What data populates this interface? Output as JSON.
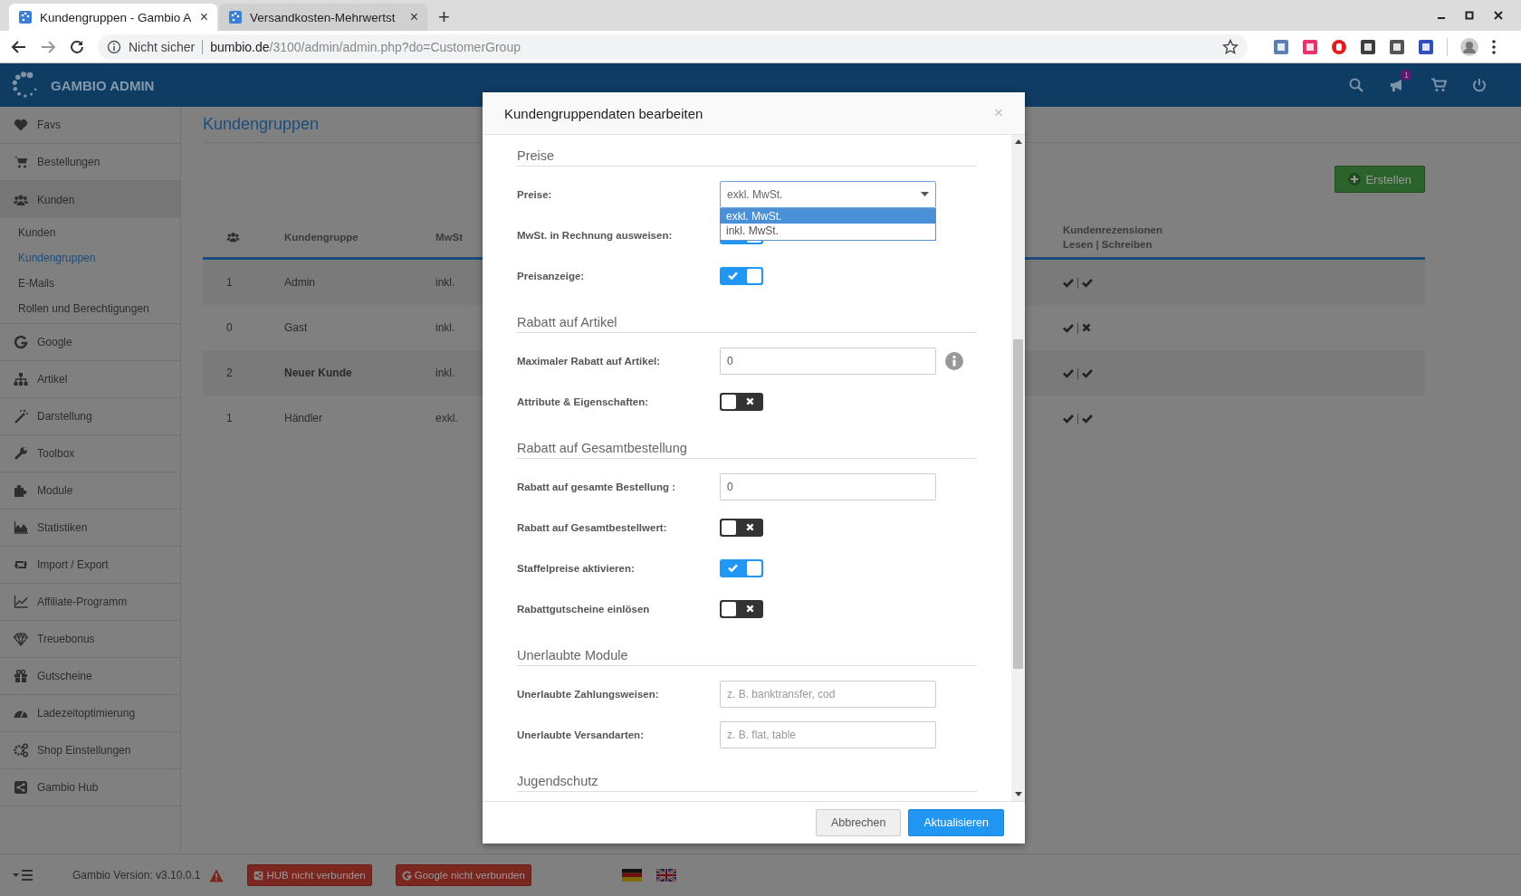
{
  "browser": {
    "tabs": [
      {
        "title": "Kundengruppen - Gambio A",
        "close": "×",
        "selected": true
      },
      {
        "title": "Versandkosten-Mehrwertst",
        "close": "×",
        "selected": false
      }
    ],
    "new_tab": "+",
    "security_label": "Nicht sicher",
    "url_host": "bumbio.de",
    "url_path": "/3100/admin/admin.php?do=CustomerGroup"
  },
  "header": {
    "brand": "GAMBIO ADMIN",
    "notification_count": "1"
  },
  "sidebar": {
    "items": [
      {
        "label": "Favs",
        "expanded": false
      },
      {
        "label": "Bestellungen",
        "expanded": false
      },
      {
        "label": "Kunden",
        "expanded": true,
        "children": [
          {
            "label": "Kunden",
            "selected": false
          },
          {
            "label": "Kundengruppen",
            "selected": true
          },
          {
            "label": "E-Mails",
            "selected": false
          },
          {
            "label": "Rollen und Berechtigungen",
            "selected": false
          }
        ]
      },
      {
        "label": "Google",
        "expanded": false
      },
      {
        "label": "Artikel",
        "expanded": false
      },
      {
        "label": "Darstellung",
        "expanded": false
      },
      {
        "label": "Toolbox",
        "expanded": false
      },
      {
        "label": "Module",
        "expanded": false
      },
      {
        "label": "Statistiken",
        "expanded": false
      },
      {
        "label": "Import / Export",
        "expanded": false
      },
      {
        "label": "Affiliate-Programm",
        "expanded": false
      },
      {
        "label": "Treuebonus",
        "expanded": false
      },
      {
        "label": "Gutscheine",
        "expanded": false
      },
      {
        "label": "Ladezeitoptimierung",
        "expanded": false
      },
      {
        "label": "Shop Einstellungen",
        "expanded": false
      },
      {
        "label": "Gambio Hub",
        "expanded": false
      }
    ]
  },
  "page": {
    "title": "Kundengruppen",
    "create_button": "Erstellen",
    "table": {
      "columns": [
        "Kundengruppe",
        "MwSt"
      ],
      "reviews_column": [
        "Kundenrezensionen",
        "Lesen | Schreiben"
      ],
      "rows": [
        {
          "members": "1",
          "name": "Admin",
          "vat": "inkl.",
          "is_default": false,
          "review_read": true,
          "review_separator": "|",
          "review_write": true
        },
        {
          "members": "0",
          "name": "Gast",
          "vat": "inkl.",
          "is_default": false,
          "review_read": true,
          "review_separator": "|",
          "review_write": false
        },
        {
          "members": "2",
          "name": "Neuer Kunde",
          "vat": "inkl.",
          "is_default": true,
          "review_read": true,
          "review_separator": "|",
          "review_write": true
        },
        {
          "members": "1",
          "name": "Händler",
          "vat": "exkl.",
          "is_default": false,
          "review_read": true,
          "review_separator": "|",
          "review_write": true
        }
      ]
    }
  },
  "modal": {
    "title": "Kundengruppendaten bearbeiten",
    "close": "×",
    "sections": [
      {
        "heading": "Preise",
        "rows": [
          {
            "kind": "select",
            "label": "Preise:",
            "value": "exkl. MwSt.",
            "options": [
              {
                "label": "exkl. MwSt.",
                "selected": true
              },
              {
                "label": "inkl. MwSt.",
                "selected": false
              }
            ]
          },
          {
            "kind": "toggle",
            "label": "MwSt. in Rechnung ausweisen:",
            "on": true
          },
          {
            "kind": "toggle",
            "label": "Preisanzeige:",
            "on": true
          }
        ]
      },
      {
        "heading": "Rabatt auf Artikel",
        "rows": [
          {
            "kind": "input",
            "label": "Maximaler Rabatt auf Artikel:",
            "value": "0",
            "info": true
          },
          {
            "kind": "toggle",
            "label": "Attribute & Eigenschaften:",
            "on": false
          }
        ]
      },
      {
        "heading": "Rabatt auf Gesamtbestellung",
        "rows": [
          {
            "kind": "input",
            "label": "Rabatt auf gesamte Bestellung :",
            "value": "0"
          },
          {
            "kind": "toggle",
            "label": "Rabatt auf Gesamtbestellwert:",
            "on": false
          },
          {
            "kind": "toggle",
            "label": "Staffelpreise aktivieren:",
            "on": true
          },
          {
            "kind": "toggle",
            "label": "Rabattgutscheine einlösen",
            "on": false
          }
        ]
      },
      {
        "heading": "Unerlaubte Module",
        "rows": [
          {
            "kind": "input",
            "label": "Unerlaubte Zahlungsweisen:",
            "placeholder": "z. B. banktransfer, cod"
          },
          {
            "kind": "input",
            "label": "Unerlaubte Versandarten:",
            "placeholder": "z. B. flat, table"
          }
        ]
      },
      {
        "heading": "Jugendschutz"
      }
    ],
    "buttons": [
      {
        "label": "Abbrechen",
        "kind": "secondary"
      },
      {
        "label": "Aktualisieren",
        "kind": "primary"
      }
    ]
  },
  "footer": {
    "version": "Gambio Version: v3.10.0.1",
    "badges": [
      "HUB nicht verbunden",
      "Google nicht verbunden"
    ]
  }
}
